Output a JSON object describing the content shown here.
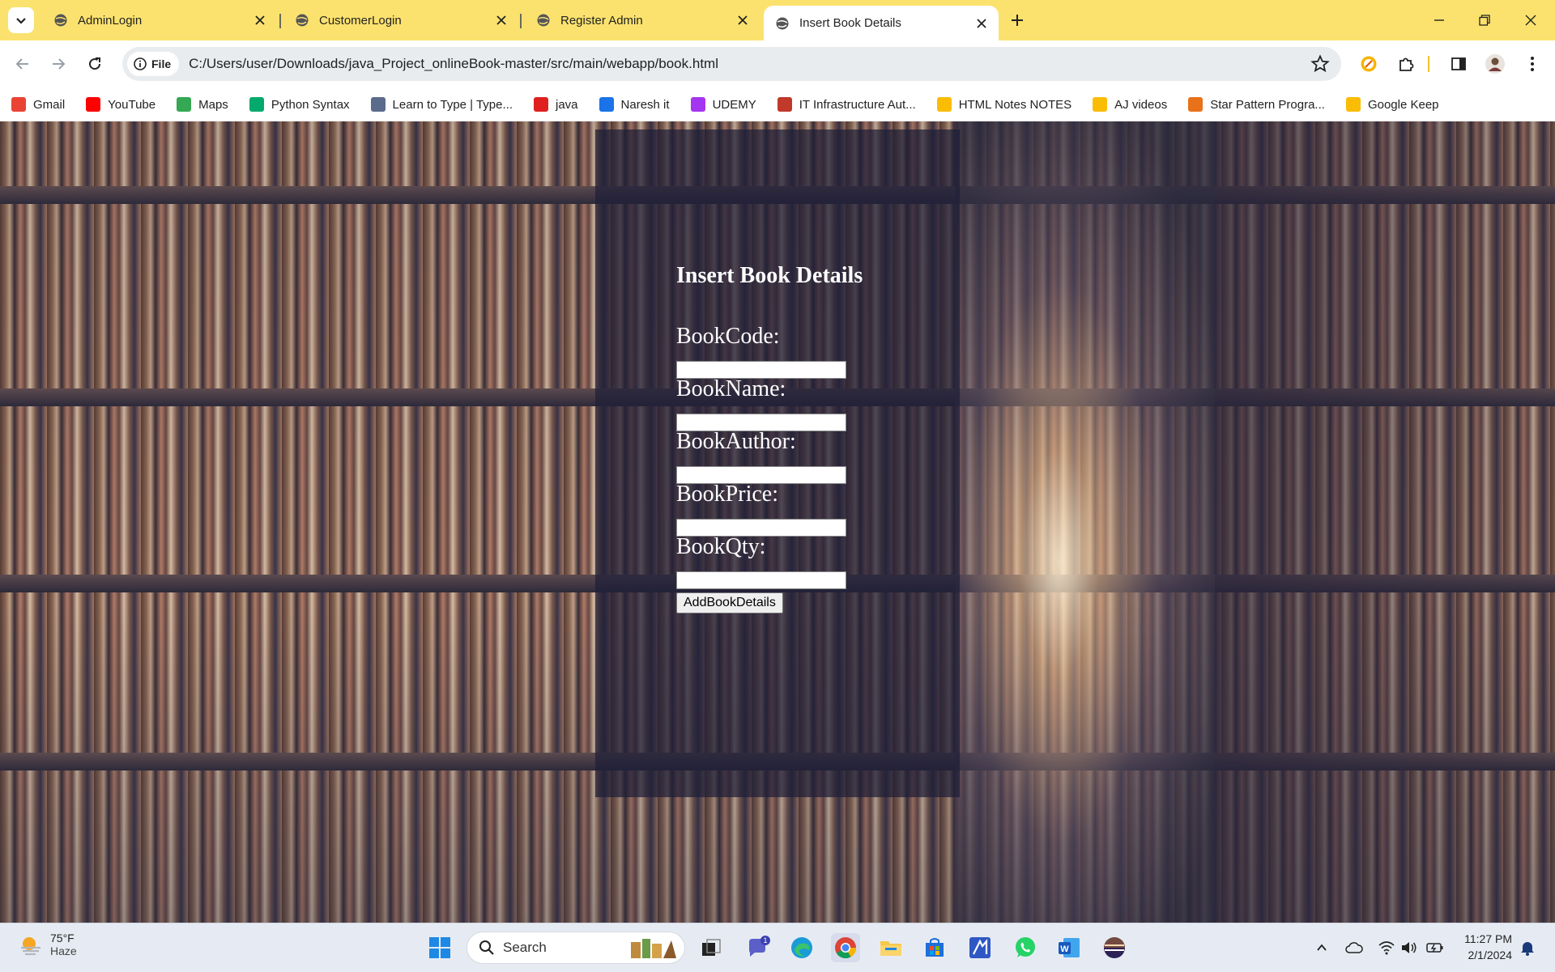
{
  "browser": {
    "tabs": [
      {
        "label": "AdminLogin"
      },
      {
        "label": "CustomerLogin"
      },
      {
        "label": "Register Admin"
      },
      {
        "label": "Insert Book Details",
        "active": true
      }
    ],
    "address": {
      "scheme_chip": "File",
      "url": "C:/Users/user/Downloads/java_Project_onlineBook-master/src/main/webapp/book.html"
    },
    "bookmarks": [
      {
        "label": "Gmail",
        "icon": "gmail-icon",
        "color": "#ea4335"
      },
      {
        "label": "YouTube",
        "icon": "youtube-icon",
        "color": "#ff0000"
      },
      {
        "label": "Maps",
        "icon": "maps-icon",
        "color": "#34a853"
      },
      {
        "label": "Python Syntax",
        "icon": "w3schools-icon",
        "color": "#04aa6d"
      },
      {
        "label": "Learn to Type | Type...",
        "icon": "typing-icon",
        "color": "#5b6b8c"
      },
      {
        "label": "java",
        "icon": "java-icon",
        "color": "#e02020"
      },
      {
        "label": "Naresh it",
        "icon": "nareshit-icon",
        "color": "#1a73e8"
      },
      {
        "label": "UDEMY",
        "icon": "udemy-icon",
        "color": "#a435f0"
      },
      {
        "label": "IT Infrastructure Aut...",
        "icon": "it-infra-icon",
        "color": "#c0392b"
      },
      {
        "label": "HTML Notes NOTES",
        "icon": "drive-icon",
        "color": "#fbbc04"
      },
      {
        "label": "AJ videos",
        "icon": "drive-icon",
        "color": "#fbbc04"
      },
      {
        "label": "Star Pattern Progra...",
        "icon": "star-pattern-icon",
        "color": "#e8711a"
      },
      {
        "label": "Google Keep",
        "icon": "keep-icon",
        "color": "#fbbc04"
      }
    ]
  },
  "page": {
    "title": "Insert Book Details",
    "fields": [
      {
        "label": "BookCode:",
        "value": ""
      },
      {
        "label": "BookName:",
        "value": ""
      },
      {
        "label": "BookAuthor:",
        "value": ""
      },
      {
        "label": "BookPrice:",
        "value": ""
      },
      {
        "label": "BookQty:",
        "value": ""
      }
    ],
    "submit_label": "AddBookDetails"
  },
  "taskbar": {
    "weather": {
      "temp": "75°F",
      "condition": "Haze"
    },
    "search_label": "Search",
    "teams_badge": "1",
    "clock": {
      "time": "11:27 PM",
      "date": "2/1/2024"
    }
  }
}
